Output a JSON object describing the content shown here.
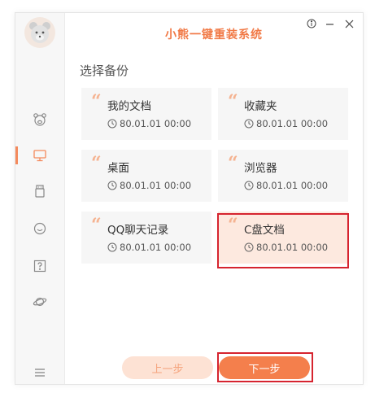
{
  "app": {
    "title": "小熊一键重装系统"
  },
  "titlebar": {
    "info_icon": "info-icon",
    "minimize_icon": "minimize-icon",
    "close_icon": "close-icon"
  },
  "sidebar": {
    "items": [
      {
        "icon": "bear-icon",
        "active": false
      },
      {
        "icon": "monitor-icon",
        "active": true
      },
      {
        "icon": "usb-drive-icon",
        "active": false
      },
      {
        "icon": "chat-bubble-icon",
        "active": false
      },
      {
        "icon": "help-icon",
        "active": false
      },
      {
        "icon": "planet-icon",
        "active": false
      }
    ],
    "menu_icon": "menu-icon"
  },
  "main": {
    "section_title": "选择备份",
    "cards": [
      {
        "name": "我的文档",
        "date": "80.01.01 00:00",
        "selected": false
      },
      {
        "name": "收藏夹",
        "date": "80.01.01 00:00",
        "selected": false
      },
      {
        "name": "桌面",
        "date": "80.01.01 00:00",
        "selected": false
      },
      {
        "name": "浏览器",
        "date": "80.01.01 00:00",
        "selected": false
      },
      {
        "name": "QQ聊天记录",
        "date": "80.01.01 00:00",
        "selected": false
      },
      {
        "name": "C盘文档",
        "date": "80.01.01 00:00",
        "selected": true
      }
    ]
  },
  "footer": {
    "prev_label": "上一步",
    "next_label": "下一步"
  },
  "colors": {
    "accent": "#f47f4c",
    "accent_light": "#fde2d4",
    "selected_card": "#fde9df",
    "highlight": "#d6242f"
  }
}
